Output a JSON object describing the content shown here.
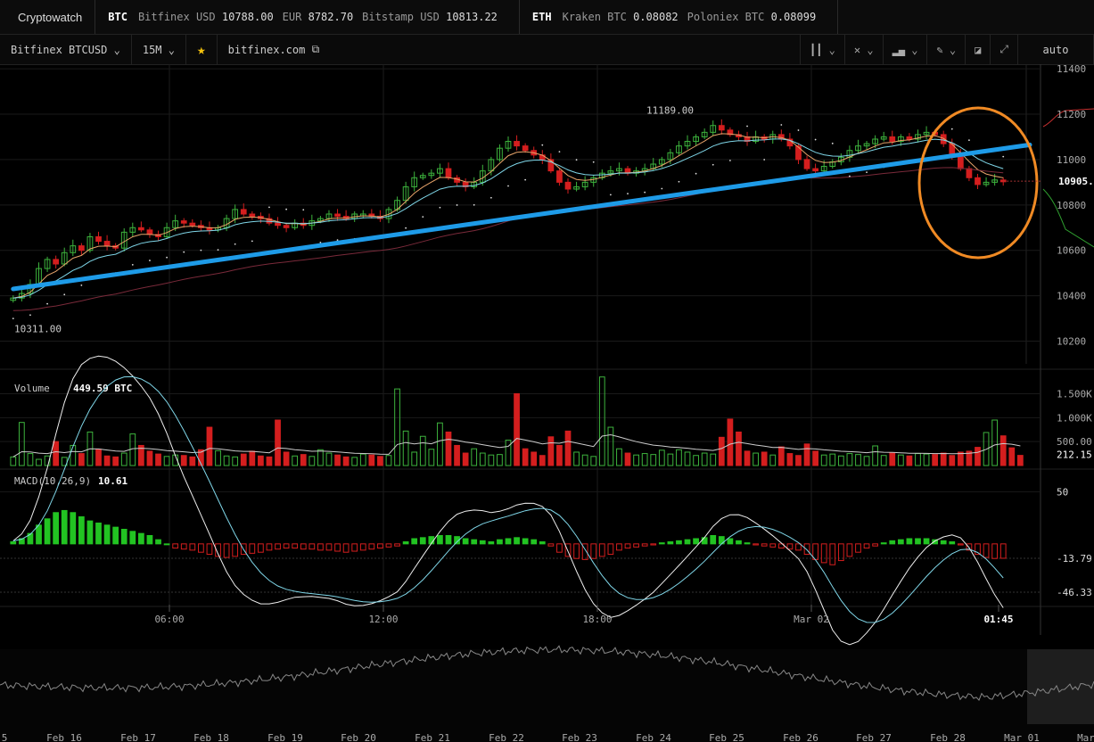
{
  "app": {
    "title": "Cryptowatch"
  },
  "ticker": {
    "btc": {
      "coin": "BTC",
      "quotes": [
        {
          "label": "Bitfinex USD",
          "value": "10788.00"
        },
        {
          "label": "EUR",
          "value": "8782.70"
        },
        {
          "label": "Bitstamp USD",
          "value": "10813.22"
        }
      ]
    },
    "eth": {
      "coin": "ETH",
      "quotes": [
        {
          "label": "Kraken BTC",
          "value": "0.08082"
        },
        {
          "label": "Poloniex BTC",
          "value": "0.08099"
        }
      ]
    }
  },
  "toolbar": {
    "market": "Bitfinex BTCUSD",
    "period": "15M",
    "exchange_link": "bitfinex.com",
    "scale": "auto"
  },
  "chart_data": [
    {
      "type": "candlestick",
      "title": "",
      "ylim": [
        10100,
        11420
      ],
      "y_ticks": [
        "11400",
        "11200",
        "11000",
        "10800",
        "10600",
        "10400",
        "10200"
      ],
      "x_ticks": [
        "06:00",
        "12:00",
        "18:00",
        "Mar 02",
        "01:45"
      ],
      "labels": {
        "high": "11189.00",
        "low": "10311.00",
        "last": "10905."
      },
      "closes": [
        10390,
        10410,
        10450,
        10520,
        10560,
        10540,
        10590,
        10620,
        10600,
        10660,
        10640,
        10620,
        10610,
        10680,
        10700,
        10690,
        10670,
        10660,
        10700,
        10730,
        10720,
        10710,
        10700,
        10690,
        10700,
        10740,
        10780,
        10760,
        10750,
        10740,
        10720,
        10710,
        10700,
        10720,
        10710,
        10730,
        10740,
        10760,
        10750,
        10740,
        10760,
        10760,
        10750,
        10740,
        10780,
        10820,
        10880,
        10920,
        10930,
        10940,
        10960,
        10920,
        10900,
        10880,
        10900,
        10950,
        11000,
        11050,
        11080,
        11060,
        11040,
        11020,
        11000,
        10950,
        10900,
        10870,
        10880,
        10900,
        10920,
        10940,
        10950,
        10960,
        10940,
        10950,
        10960,
        10980,
        11000,
        11030,
        11060,
        11080,
        11100,
        11120,
        11150,
        11130,
        11110,
        11100,
        11080,
        11100,
        11090,
        11110,
        11090,
        11060,
        11000,
        10960,
        10950,
        10970,
        10990,
        11010,
        11040,
        11060,
        11070,
        11090,
        11100,
        11080,
        11100,
        11090,
        11110,
        11120,
        11110,
        11070,
        11020,
        10960,
        10920,
        10890,
        10900,
        10910,
        10905
      ],
      "overlays": [
        "trendline",
        "ema",
        "sma",
        "sar"
      ],
      "annotations": [
        "trend line",
        "highlight circle"
      ]
    },
    {
      "type": "bar",
      "title": "Volume",
      "label": "Volume",
      "value_label": "449.59 BTC",
      "y_ticks": [
        "1.500K",
        "1.000K",
        "500.00"
      ],
      "last": "212.15",
      "values": [
        180,
        900,
        250,
        130,
        200,
        500,
        170,
        420,
        250,
        700,
        340,
        200,
        180,
        260,
        660,
        420,
        300,
        240,
        190,
        220,
        210,
        180,
        330,
        800,
        310,
        200,
        180,
        240,
        300,
        200,
        180,
        950,
        280,
        200,
        230,
        190,
        330,
        260,
        220,
        180,
        170,
        240,
        220,
        190,
        210,
        1600,
        720,
        280,
        610,
        340,
        890,
        700,
        420,
        260,
        350,
        260,
        220,
        230,
        530,
        1500,
        350,
        280,
        210,
        600,
        420,
        720,
        280,
        220,
        190,
        1850,
        800,
        350,
        260,
        220,
        250,
        230,
        320,
        240,
        330,
        280,
        210,
        260,
        240,
        590,
        970,
        700,
        300,
        260,
        280,
        220,
        390,
        250,
        210,
        450,
        300,
        220,
        240,
        200,
        250,
        230,
        190,
        410,
        210,
        260,
        220,
        200,
        250,
        240,
        230,
        260,
        210,
        280,
        300,
        380,
        690,
        950,
        620,
        370,
        212
      ]
    },
    {
      "type": "bar",
      "title": "MACD(10,26,9)",
      "label": "MACD(10,26,9)",
      "value_label": "10.61",
      "y_ticks": [
        "50",
        "-13.79",
        "-46.33"
      ],
      "values": [
        2,
        5,
        10,
        18,
        24,
        30,
        32,
        30,
        26,
        22,
        20,
        18,
        16,
        14,
        12,
        10,
        8,
        4,
        0,
        -4,
        -5,
        -6,
        -8,
        -10,
        -12,
        -13,
        -12,
        -10,
        -9,
        -8,
        -6,
        -5,
        -4,
        -4,
        -5,
        -5,
        -6,
        -6,
        -7,
        -8,
        -7,
        -6,
        -5,
        -4,
        -3,
        -2,
        2,
        5,
        6,
        7,
        8,
        8,
        7,
        5,
        4,
        3,
        2,
        4,
        5,
        6,
        5,
        4,
        2,
        -2,
        -8,
        -12,
        -14,
        -15,
        -14,
        -12,
        -10,
        -6,
        -4,
        -3,
        -2,
        -1,
        1,
        2,
        3,
        4,
        5,
        6,
        8,
        7,
        5,
        3,
        1,
        -1,
        -2,
        -3,
        -4,
        -5,
        -6,
        -10,
        -15,
        -18,
        -20,
        -16,
        -12,
        -8,
        -4,
        -2,
        1,
        3,
        4,
        5,
        5,
        5,
        4,
        3,
        2,
        -1,
        -6,
        -10,
        -13,
        -14,
        -13.79
      ]
    }
  ],
  "navigator": {
    "dates": [
      "5",
      "Feb 16",
      "Feb 17",
      "Feb 18",
      "Feb 19",
      "Feb 20",
      "Feb 21",
      "Feb 22",
      "Feb 23",
      "Feb 24",
      "Feb 25",
      "Feb 26",
      "Feb 27",
      "Feb 28",
      "Mar 01",
      "Mar"
    ]
  }
}
